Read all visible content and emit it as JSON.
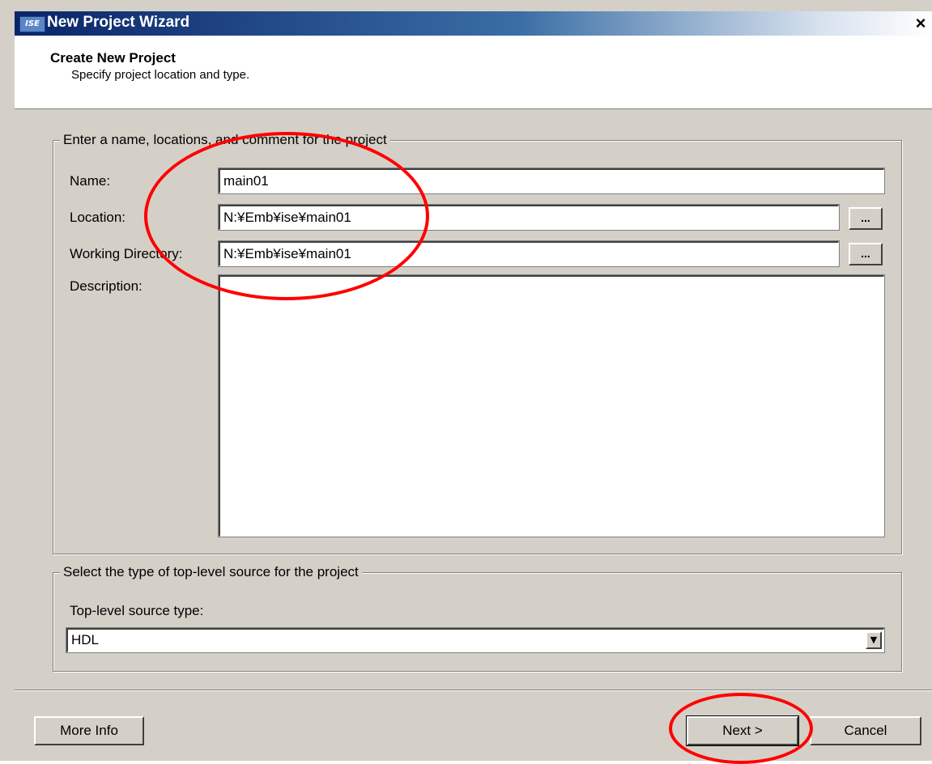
{
  "window": {
    "title": "New Project Wizard",
    "icon": "ise-app-icon",
    "close_glyph": "×"
  },
  "header": {
    "title": "Create New Project",
    "subtitle": "Specify project location and type."
  },
  "project_group": {
    "legend": "Enter a name, locations, and comment for the project",
    "name_label": "Name:",
    "name_value": "main01",
    "location_label": "Location:",
    "location_value": "N:¥Emb¥ise¥main01",
    "workdir_label": "Working Directory:",
    "workdir_value": "N:¥Emb¥ise¥main01",
    "browse_label": "...",
    "description_label": "Description:",
    "description_value": ""
  },
  "source_group": {
    "legend": "Select the type of top-level source for the project",
    "type_label": "Top-level source type:",
    "type_value": "HDL"
  },
  "buttons": {
    "more_info": "More Info",
    "next": "Next >",
    "cancel": "Cancel"
  },
  "colors": {
    "title_gradient_start": "#0a246a",
    "dialog_bg": "#d4d0c8",
    "annotation": "#ff0000"
  }
}
